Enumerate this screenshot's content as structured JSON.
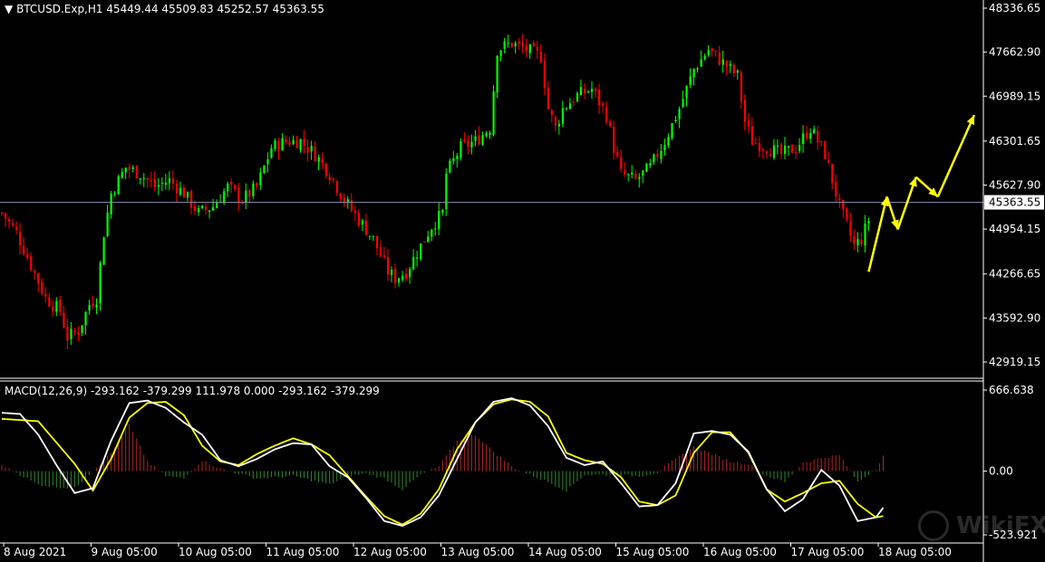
{
  "header": {
    "symbol": "BTCUSD.Exp,H1",
    "ohlc": "45449.44 45509.83 45252.57 45363.55"
  },
  "macd_header": "MACD(12,26,9) -293.162 -379.299 111.978 0.000 -293.162 -379.299",
  "watermark": "WikiFX",
  "colors": {
    "background": "#000000",
    "bull_candle": "#00ff00",
    "bear_candle": "#ff0000",
    "axis": "#ffffff",
    "price_line": "#8b93b5",
    "macd_line": "#ffffff",
    "signal_line": "#ffff00",
    "hist_pos": "#b22222",
    "hist_neg": "#2e8b2e",
    "arrow": "#ffff00"
  },
  "chart_data": [
    {
      "type": "candlestick",
      "title": "BTCUSD.Exp,H1",
      "ylim": [
        42700,
        48400
      ],
      "price_ticks": [
        "48336.65",
        "47662.90",
        "46989.15",
        "46301.65",
        "45627.90",
        "44954.15",
        "44266.65",
        "43592.90",
        "42919.15"
      ],
      "current_price": "45363.55",
      "x_labels": [
        "8 Aug 2021",
        "9 Aug 05:00",
        "10 Aug 05:00",
        "11 Aug 05:00",
        "12 Aug 05:00",
        "13 Aug 05:00",
        "14 Aug 05:00",
        "15 Aug 05:00",
        "16 Aug 05:00",
        "17 Aug 05:00",
        "18 Aug 05:00"
      ],
      "close_path": [
        [
          0,
          45200
        ],
        [
          4,
          44900
        ],
        [
          8,
          44400
        ],
        [
          12,
          43900
        ],
        [
          16,
          43700
        ],
        [
          18,
          43300
        ],
        [
          21,
          43400
        ],
        [
          24,
          43800
        ],
        [
          26,
          43900
        ],
        [
          28,
          44900
        ],
        [
          30,
          45500
        ],
        [
          34,
          45900
        ],
        [
          38,
          45800
        ],
        [
          42,
          45600
        ],
        [
          46,
          45700
        ],
        [
          50,
          45500
        ],
        [
          54,
          45200
        ],
        [
          58,
          45300
        ],
        [
          62,
          45600
        ],
        [
          66,
          45400
        ],
        [
          70,
          45600
        ],
        [
          74,
          46200
        ],
        [
          78,
          46300
        ],
        [
          82,
          46300
        ],
        [
          86,
          46100
        ],
        [
          90,
          45800
        ],
        [
          94,
          45400
        ],
        [
          98,
          45100
        ],
        [
          102,
          44800
        ],
        [
          106,
          44300
        ],
        [
          108,
          44200
        ],
        [
          111,
          44300
        ],
        [
          114,
          44600
        ],
        [
          118,
          45000
        ],
        [
          121,
          45200
        ],
        [
          122,
          45800
        ],
        [
          126,
          46200
        ],
        [
          130,
          46300
        ],
        [
          134,
          46500
        ],
        [
          136,
          47700
        ],
        [
          140,
          47800
        ],
        [
          144,
          47700
        ],
        [
          148,
          47600
        ],
        [
          150,
          46800
        ],
        [
          152,
          46500
        ],
        [
          154,
          46800
        ],
        [
          158,
          47000
        ],
        [
          162,
          47100
        ],
        [
          166,
          46700
        ],
        [
          168,
          46200
        ],
        [
          170,
          45800
        ],
        [
          174,
          45700
        ],
        [
          178,
          45900
        ],
        [
          182,
          46300
        ],
        [
          186,
          46800
        ],
        [
          190,
          47400
        ],
        [
          194,
          47700
        ],
        [
          198,
          47500
        ],
        [
          202,
          47300
        ],
        [
          204,
          46600
        ],
        [
          206,
          46300
        ],
        [
          210,
          46200
        ],
        [
          214,
          46100
        ],
        [
          218,
          46200
        ],
        [
          222,
          46500
        ],
        [
          226,
          46100
        ],
        [
          228,
          45700
        ],
        [
          230,
          45300
        ],
        [
          232,
          45000
        ],
        [
          234,
          44700
        ],
        [
          236,
          44800
        ],
        [
          238,
          45100
        ]
      ],
      "arrows": [
        {
          "from": [
            238,
            44300
          ],
          "to": [
            243,
            45450
          ]
        },
        {
          "from": [
            243,
            45450
          ],
          "to": [
            246,
            44950
          ]
        },
        {
          "from": [
            246,
            44950
          ],
          "to": [
            251,
            45750
          ]
        },
        {
          "from": [
            251,
            45750
          ],
          "to": [
            257,
            45450
          ]
        },
        {
          "from": [
            257,
            45450
          ],
          "to": [
            267,
            46700
          ]
        }
      ]
    },
    {
      "type": "macd",
      "title": "MACD(12,26,9)",
      "ylim": [
        -523.921,
        666.638
      ],
      "tick_labels": [
        "666.638",
        "0.00",
        "-523.921"
      ],
      "macd": [
        [
          0,
          480
        ],
        [
          5,
          470
        ],
        [
          10,
          300
        ],
        [
          15,
          50
        ],
        [
          20,
          -180
        ],
        [
          25,
          -140
        ],
        [
          30,
          250
        ],
        [
          35,
          560
        ],
        [
          40,
          580
        ],
        [
          45,
          520
        ],
        [
          50,
          400
        ],
        [
          55,
          300
        ],
        [
          60,
          90
        ],
        [
          65,
          40
        ],
        [
          70,
          100
        ],
        [
          75,
          180
        ],
        [
          80,
          230
        ],
        [
          85,
          220
        ],
        [
          90,
          40
        ],
        [
          95,
          -50
        ],
        [
          100,
          -220
        ],
        [
          105,
          -410
        ],
        [
          110,
          -450
        ],
        [
          115,
          -380
        ],
        [
          120,
          -200
        ],
        [
          125,
          100
        ],
        [
          130,
          400
        ],
        [
          135,
          570
        ],
        [
          140,
          600
        ],
        [
          145,
          540
        ],
        [
          150,
          370
        ],
        [
          155,
          110
        ],
        [
          160,
          50
        ],
        [
          165,
          80
        ],
        [
          170,
          -100
        ],
        [
          175,
          -290
        ],
        [
          180,
          -280
        ],
        [
          185,
          -100
        ],
        [
          190,
          310
        ],
        [
          195,
          330
        ],
        [
          200,
          300
        ],
        [
          205,
          160
        ],
        [
          210,
          -150
        ],
        [
          215,
          -330
        ],
        [
          220,
          -230
        ],
        [
          225,
          10
        ],
        [
          230,
          -120
        ],
        [
          235,
          -410
        ],
        [
          240,
          -380
        ],
        [
          242,
          -300
        ]
      ],
      "signal": [
        [
          0,
          430
        ],
        [
          10,
          410
        ],
        [
          20,
          60
        ],
        [
          25,
          -160
        ],
        [
          30,
          100
        ],
        [
          35,
          440
        ],
        [
          40,
          560
        ],
        [
          45,
          570
        ],
        [
          50,
          460
        ],
        [
          55,
          210
        ],
        [
          60,
          80
        ],
        [
          65,
          50
        ],
        [
          70,
          140
        ],
        [
          75,
          210
        ],
        [
          80,
          270
        ],
        [
          85,
          220
        ],
        [
          90,
          130
        ],
        [
          95,
          -40
        ],
        [
          100,
          -210
        ],
        [
          105,
          -370
        ],
        [
          110,
          -440
        ],
        [
          115,
          -350
        ],
        [
          120,
          -150
        ],
        [
          125,
          180
        ],
        [
          130,
          400
        ],
        [
          135,
          550
        ],
        [
          140,
          590
        ],
        [
          145,
          570
        ],
        [
          150,
          450
        ],
        [
          155,
          150
        ],
        [
          160,
          90
        ],
        [
          165,
          60
        ],
        [
          170,
          -50
        ],
        [
          175,
          -250
        ],
        [
          180,
          -280
        ],
        [
          185,
          -200
        ],
        [
          190,
          150
        ],
        [
          195,
          320
        ],
        [
          200,
          320
        ],
        [
          205,
          150
        ],
        [
          210,
          -150
        ],
        [
          215,
          -250
        ],
        [
          220,
          -180
        ],
        [
          225,
          -100
        ],
        [
          230,
          -80
        ],
        [
          235,
          -270
        ],
        [
          240,
          -380
        ],
        [
          242,
          -370
        ]
      ],
      "histogram": [
        [
          0,
          50
        ],
        [
          10,
          -110
        ],
        [
          15,
          -130
        ],
        [
          20,
          -140
        ],
        [
          30,
          150
        ],
        [
          35,
          380
        ],
        [
          40,
          80
        ],
        [
          45,
          -40
        ],
        [
          50,
          -60
        ],
        [
          55,
          90
        ],
        [
          60,
          20
        ],
        [
          70,
          -60
        ],
        [
          80,
          -40
        ],
        [
          90,
          -110
        ],
        [
          95,
          -40
        ],
        [
          100,
          -20
        ],
        [
          105,
          -60
        ],
        [
          110,
          -150
        ],
        [
          115,
          -30
        ],
        [
          120,
          40
        ],
        [
          125,
          250
        ],
        [
          130,
          300
        ],
        [
          135,
          160
        ],
        [
          140,
          40
        ],
        [
          145,
          -30
        ],
        [
          150,
          -90
        ],
        [
          155,
          -160
        ],
        [
          160,
          -30
        ],
        [
          170,
          -30
        ],
        [
          175,
          -40
        ],
        [
          180,
          -10
        ],
        [
          185,
          100
        ],
        [
          190,
          200
        ],
        [
          195,
          140
        ],
        [
          200,
          80
        ],
        [
          205,
          60
        ],
        [
          210,
          -40
        ],
        [
          215,
          -90
        ],
        [
          220,
          70
        ],
        [
          225,
          110
        ],
        [
          230,
          130
        ],
        [
          235,
          -90
        ],
        [
          240,
          20
        ],
        [
          242,
          130
        ]
      ]
    }
  ]
}
